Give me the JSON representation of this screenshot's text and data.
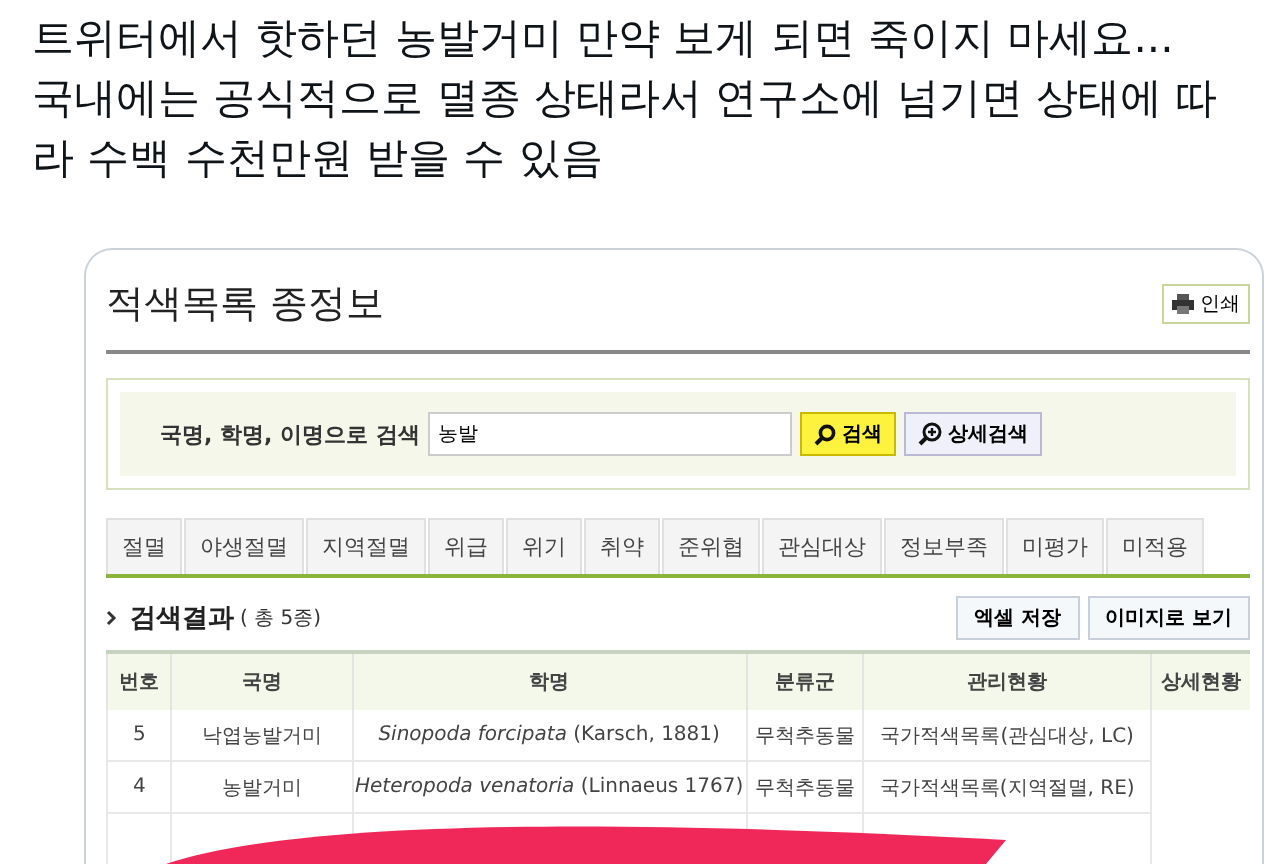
{
  "post_text": "트위터에서 핫하던 농발거미 만약 보게 되면 죽이지 마세요... 국내에는 공식적으로 멸종 상태라서 연구소에 넘기면 상태에 따라 수백 수천만원 받을 수 있음",
  "page": {
    "title": "적색목록 종정보",
    "print_button": "인쇄"
  },
  "search": {
    "label": "국명, 학명, 이명으로 검색",
    "value": "농발",
    "search_button": "검색",
    "advanced_button": "상세검색"
  },
  "tabs": [
    {
      "label": "절멸",
      "selected": false
    },
    {
      "label": "야생절멸",
      "selected": false
    },
    {
      "label": "지역절멸",
      "selected": false
    },
    {
      "label": "위급",
      "selected": false
    },
    {
      "label": "위기",
      "selected": false
    },
    {
      "label": "취약",
      "selected": false
    },
    {
      "label": "준위협",
      "selected": false
    },
    {
      "label": "관심대상",
      "selected": false
    },
    {
      "label": "정보부족",
      "selected": false
    },
    {
      "label": "미평가",
      "selected": false
    },
    {
      "label": "미적용",
      "selected": false
    }
  ],
  "results": {
    "heading": "검색결과",
    "count": "( 총 5종)",
    "buttons": [
      "엑셀 저장",
      "이미지로 보기"
    ]
  },
  "table": {
    "columns": [
      "번호",
      "국명",
      "학명",
      "분류군",
      "관리현황",
      "상세현황"
    ],
    "rows": [
      [
        "5",
        "낙엽농발거미",
        "*Sinopoda forcipata* (Karsch, 1881)",
        "무척추동물",
        "국가적색목록(관심대상, LC)",
        ""
      ],
      [
        "4",
        "농발거미",
        "*Heteropoda venatoria* (Linnaeus 1767)",
        "무척추동물",
        "국가적색목록(지역절멸, RE)",
        ""
      ]
    ]
  }
}
